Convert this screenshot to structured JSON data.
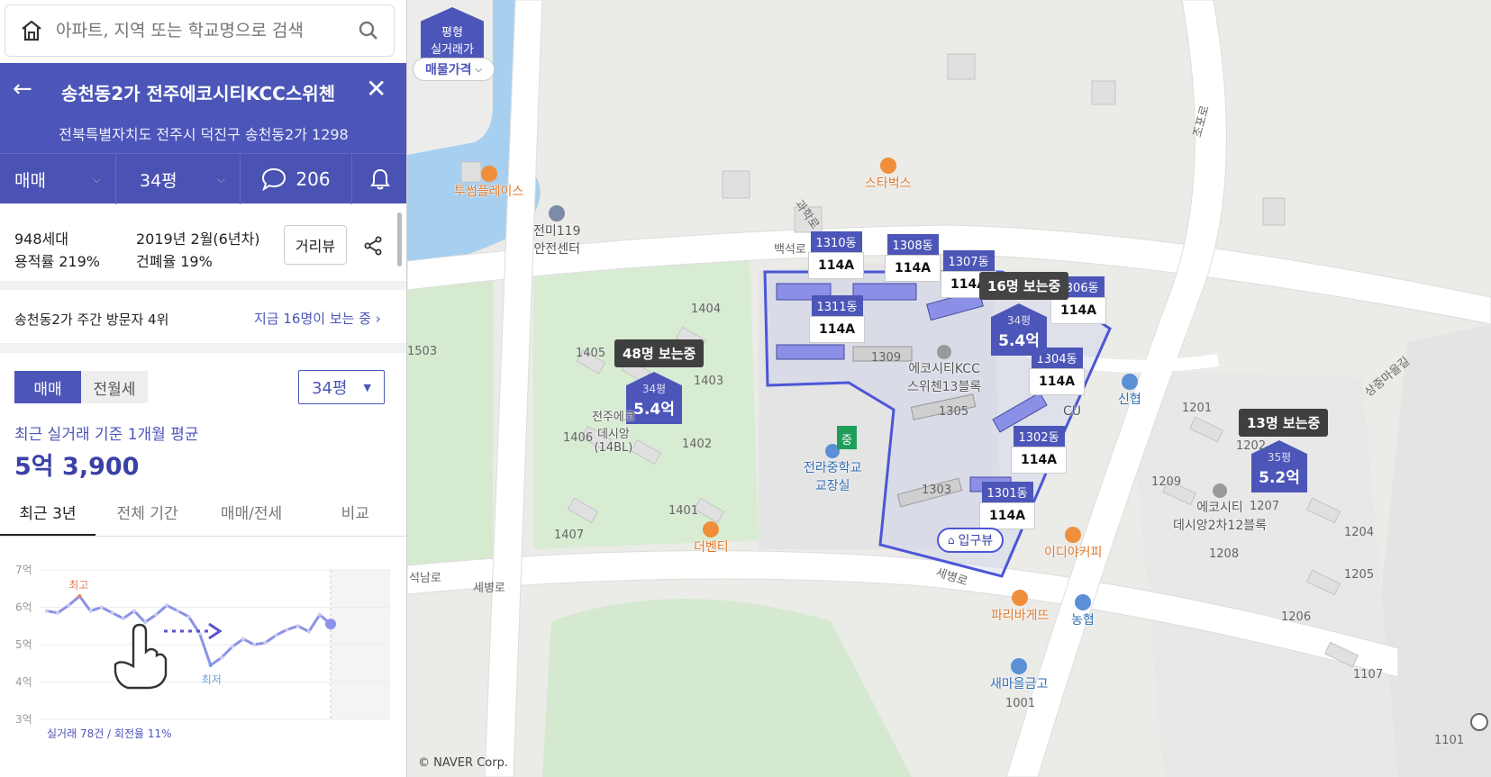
{
  "search": {
    "placeholder": "아파트, 지역 또는 학교명으로 검색"
  },
  "complex": {
    "title": "송천동2가 전주에코시티KCC스위첸",
    "address": "전북특별자치도 전주시 덕진구 송천동2가 1298"
  },
  "tabs": {
    "trade": "매매",
    "size": "34평",
    "comments": "206"
  },
  "info": {
    "households": "948세대",
    "built": "2019년 2월(6년차)",
    "far": "용적률 219%",
    "bcr": "건폐율 19%",
    "street_view": "거리뷰"
  },
  "visitors": {
    "rank_text": "송천동2가 주간 방문자 4위",
    "now_text": "지금 16명이 보는 중"
  },
  "price": {
    "seg_trade": "매매",
    "seg_lease": "전월세",
    "size_select": "34평",
    "caption": "최근 실거래 기준 1개월 평균",
    "value": "5억 3,900"
  },
  "period_tabs": [
    "최근 3년",
    "전체 기간",
    "매매/전세",
    "비교"
  ],
  "chart_data": {
    "type": "line",
    "title": "",
    "ylabel": "",
    "ylim": [
      3,
      7
    ],
    "y_ticks": [
      "7억",
      "6억",
      "5억",
      "4억",
      "3억"
    ],
    "series": [
      {
        "name": "",
        "values": [
          5.9,
          5.85,
          6.05,
          6.3,
          5.9,
          6.0,
          5.85,
          5.7,
          5.9,
          5.6,
          5.8,
          6.05,
          5.9,
          5.75,
          5.3,
          4.45,
          4.65,
          4.95,
          5.15,
          5.0,
          5.05,
          5.25,
          5.4,
          5.5,
          5.35,
          5.8,
          5.55
        ]
      }
    ],
    "max_label": "최고",
    "min_label": "최저",
    "footer": "실거래 78건 / 회전율 11%"
  },
  "map": {
    "mode_top": "평형",
    "mode_bottom": "실거래가",
    "price_filter": "매물가격",
    "copyright": "© NAVER Corp.",
    "buildings": [
      {
        "label": "1310동",
        "type": "114A"
      },
      {
        "label": "1308동",
        "type": "114A"
      },
      {
        "label": "1307동",
        "type": "114A"
      },
      {
        "label": "1311동",
        "type": "114A"
      },
      {
        "label": "1306동",
        "type": "114A"
      },
      {
        "label": "1304동",
        "type": "114A"
      },
      {
        "label": "1302동",
        "type": "114A"
      },
      {
        "label": "1301동",
        "type": "114A"
      }
    ],
    "viewers": [
      "48명 보는중",
      "16명 보는중",
      "13명 보는중"
    ],
    "markers": [
      {
        "size": "34평",
        "price": "5.4억",
        "color": "#4c56b8"
      },
      {
        "size": "34평",
        "price": "5.4억",
        "color": "#4c56b8"
      },
      {
        "size": "35평",
        "price": "5.2억",
        "color": "#4c56b8"
      }
    ],
    "pois": [
      {
        "name": "투썸플레이스",
        "color": "#e07b2c"
      },
      {
        "name": "스타벅스",
        "color": "#e07b2c"
      },
      {
        "name": "전미119\n안전센터",
        "color": "#555"
      },
      {
        "name": "더벤티",
        "color": "#e07b2c"
      },
      {
        "name": "이디야커피",
        "color": "#e07b2c"
      },
      {
        "name": "파리바게뜨",
        "color": "#e07b2c"
      },
      {
        "name": "신협",
        "color": "#2f6db5"
      },
      {
        "name": "농협",
        "color": "#2f6db5"
      },
      {
        "name": "새마을금고",
        "color": "#2f6db5"
      },
      {
        "name": "전라중학교\n교장실",
        "color": "#2f6db5"
      },
      {
        "name": "에코시티KCC\n스위첸13블록",
        "color": "#555"
      },
      {
        "name": "에코시티\n데시앙2차12블록",
        "color": "#555"
      },
      {
        "name": "전주에코\n데시앙\n(14BL)",
        "color": "#555"
      },
      {
        "name": "CU",
        "color": "#555"
      }
    ],
    "roads": [
      "백석로",
      "세병로",
      "세병로",
      "석남로",
      "과학로",
      "조포로",
      "상중마을길"
    ],
    "entrance": "입구뷰",
    "school_flag": "중",
    "dongs": [
      "1404",
      "1405",
      "1403",
      "1406",
      "1402",
      "1401",
      "1407",
      "1503",
      "1309",
      "1305",
      "1303",
      "1201",
      "1202",
      "1209",
      "1207",
      "1208",
      "1204",
      "1205",
      "1206",
      "1107",
      "1001",
      "1101"
    ]
  }
}
